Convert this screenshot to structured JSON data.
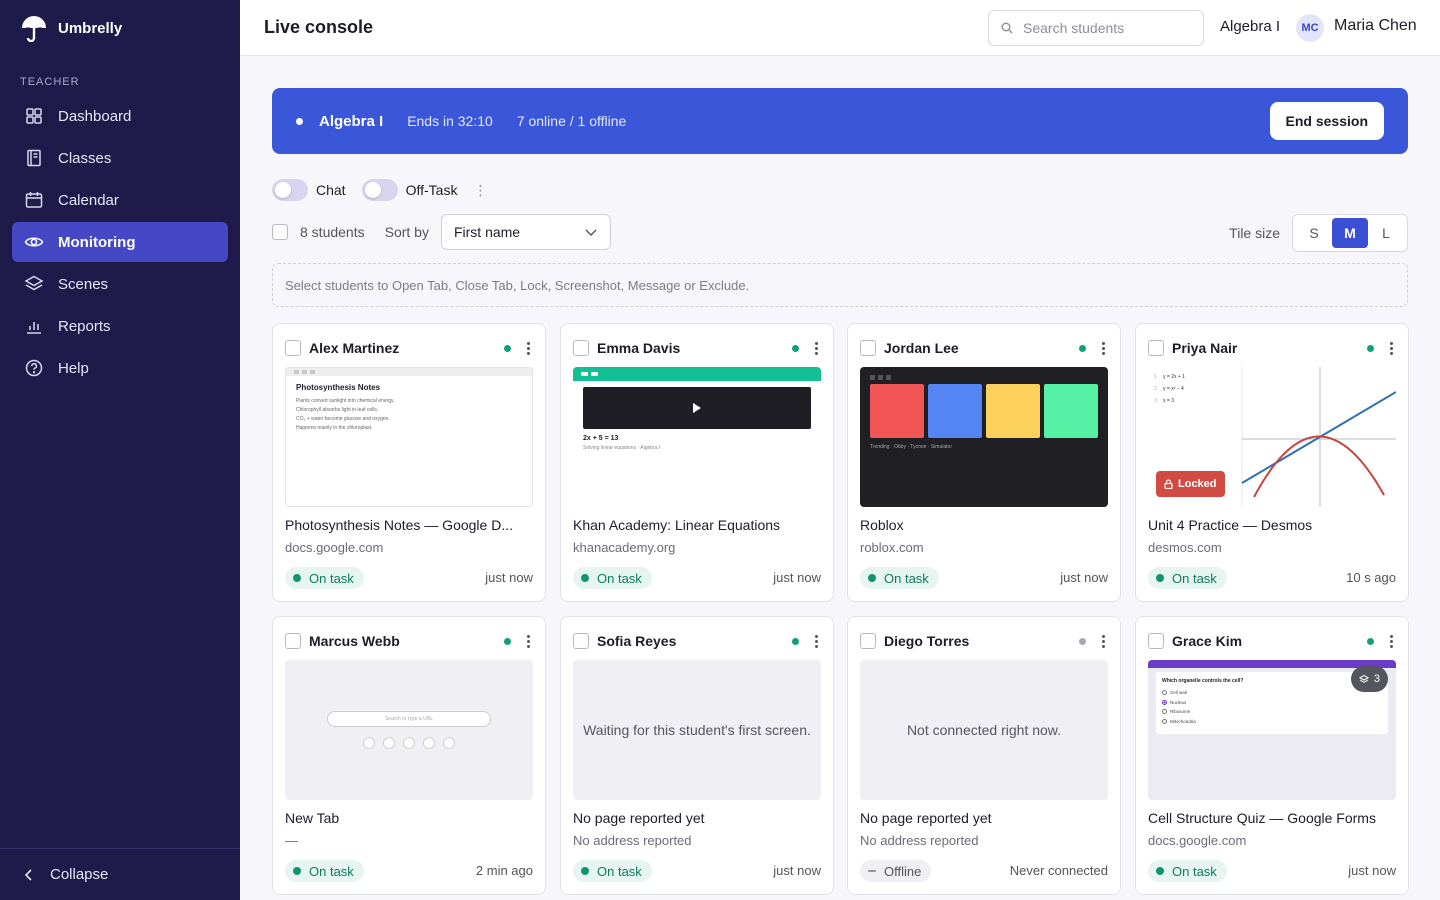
{
  "app": {
    "name": "Umbrelly"
  },
  "sidebar": {
    "section": "TEACHER",
    "items": [
      {
        "label": "Dashboard",
        "icon": "grid-icon"
      },
      {
        "label": "Classes",
        "icon": "book-icon"
      },
      {
        "label": "Calendar",
        "icon": "calendar-icon"
      },
      {
        "label": "Monitoring",
        "icon": "eye-icon",
        "active": true
      },
      {
        "label": "Scenes",
        "icon": "layers-icon"
      },
      {
        "label": "Reports",
        "icon": "bar-chart-icon"
      },
      {
        "label": "Help",
        "icon": "help-circle-icon"
      }
    ],
    "collapse_label": "Collapse"
  },
  "header": {
    "title": "Live console",
    "search_placeholder": "Search students",
    "class_name": "Algebra I",
    "user_initials": "MC",
    "user_name": "Maria Chen"
  },
  "session": {
    "class_name": "Algebra I",
    "ends_in": "Ends in 32:10",
    "presence": "7 online / 1 offline",
    "end_label": "End session"
  },
  "toggles": {
    "chat_label": "Chat",
    "offtask_label": "Off-Task"
  },
  "toolbar": {
    "count_label": "8 students",
    "sort_label": "Sort by",
    "sort_value": "First name",
    "tile_size_label": "Tile size",
    "sizes": [
      "S",
      "M",
      "L"
    ],
    "active_size": "M"
  },
  "hint": "Select students to Open Tab, Close Tab, Lock, Screenshot, Message or Exclude.",
  "tiles": [
    {
      "name": "Alex Martinez",
      "title": "Photosynthesis Notes — Google D...",
      "url": "docs.google.com",
      "status": "On task",
      "time": "just now"
    },
    {
      "name": "Emma Davis",
      "title": "Khan Academy: Linear Equations",
      "url": "khanacademy.org",
      "status": "On task",
      "time": "just now"
    },
    {
      "name": "Jordan Lee",
      "title": "Roblox",
      "url": "roblox.com",
      "status": "On task",
      "time": "just now"
    },
    {
      "name": "Priya Nair",
      "title": "Unit 4 Practice — Desmos",
      "url": "desmos.com",
      "status": "On task",
      "time": "10 s ago",
      "locked_label": "Locked"
    },
    {
      "name": "Marcus Webb",
      "title": "New Tab",
      "url": "—",
      "status": "On task",
      "time": "2 min ago"
    },
    {
      "name": "Sofia Reyes",
      "title": "No page reported yet",
      "url": "No address reported",
      "status": "On task",
      "time": "just now",
      "message": "Waiting for this student's first screen."
    },
    {
      "name": "Diego Torres",
      "title": "No page reported yet",
      "url": "No address reported",
      "status": "Offline",
      "time": "Never connected",
      "message": "Not connected right now."
    },
    {
      "name": "Grace Kim",
      "title": "Cell Structure Quiz — Google Forms",
      "url": "docs.google.com",
      "status": "On task",
      "time": "just now",
      "tab_count": "3"
    }
  ],
  "screens": {
    "doc": {
      "heading": "Photosynthesis Notes",
      "lines": [
        "Plants convert sunlight into chemical energy.",
        "Chlorophyll absorbs light in leaf cells.",
        "CO₂ + water become glucose and oxygen.",
        "Happens mainly in the chloroplast."
      ]
    },
    "khan": {
      "equation": "2x + 5 = 13",
      "caption": "Solving linear equations · Algebra I"
    },
    "roblox": {
      "caption": "Trending · Obby · Tycoon · Simulator",
      "tile_colors": [
        "#f25555",
        "#5585f2",
        "#fbd05c",
        "#55f2a6"
      ]
    },
    "desmos": {
      "expressions": [
        "y = 2x + 1",
        "y = x² − 4",
        "x = 3"
      ]
    },
    "newtab": {
      "placeholder": "Search or type a URL"
    },
    "forms": {
      "question": "Which organelle controls the cell?",
      "options": [
        "Cell wall",
        "Nucleus",
        "Ribosome",
        "Mitochondria"
      ],
      "selected": 1
    }
  },
  "colors": {
    "sidebar": "#1e1b4b",
    "accent": "#3b57d9",
    "active_nav": "#4448c4",
    "on_task": "#12956f",
    "locked": "#d24b43"
  }
}
